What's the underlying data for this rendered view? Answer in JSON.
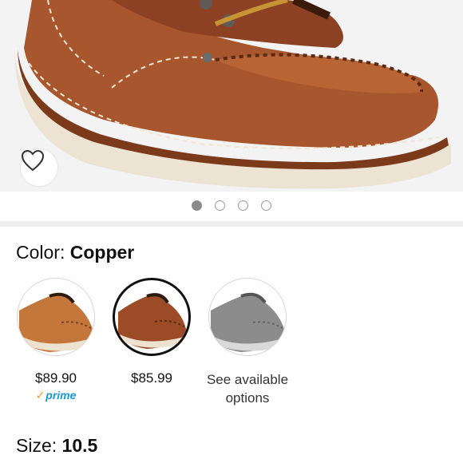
{
  "product": {
    "color_label": "Color:",
    "color_value": "Copper",
    "size_label": "Size:",
    "size_value": "10.5"
  },
  "gallery": {
    "image_count": 4,
    "active_index": 0
  },
  "swatches": [
    {
      "price": "$89.90",
      "badge_check": "✓",
      "badge_text": "prime"
    },
    {
      "price": "$85.99"
    },
    {
      "text": "See available options"
    }
  ]
}
